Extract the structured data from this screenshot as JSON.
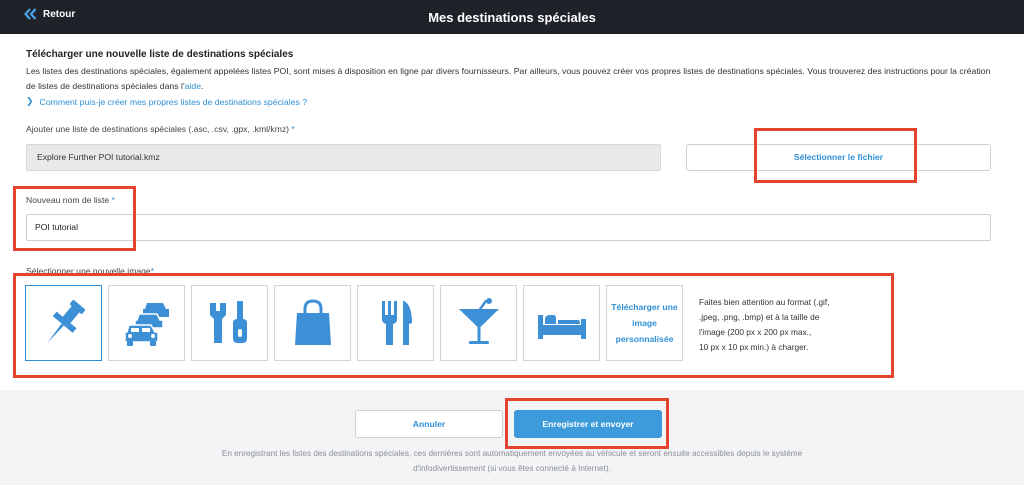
{
  "header": {
    "back_label": "Retour",
    "title": "Mes destinations spéciales"
  },
  "intro": {
    "heading": "Télécharger une nouvelle liste de destinations spéciales",
    "text_1": "Les listes des destinations spéciales, également appelées listes POI, sont mises à disposition en ligne par divers fournisseurs. Par ailleurs, vous pouvez créer vos propres listes de destinations spéciales. Vous trouverez des instructions pour la création de listes de destinations spéciales dans l'",
    "help_link": "aide",
    "text_2": ".",
    "howto_link": "Comment puis-je créer mes propres listes de destinations spéciales ?"
  },
  "file": {
    "label": "Ajouter une liste de destinations spéciales (.asc, .csv, .gpx, .kml/kmz)",
    "required_mark": "*",
    "value": "Explore Further POI tutorial.kmz",
    "select_button": "Sélectionner le fichier"
  },
  "list_name": {
    "label": "Nouveau nom de liste",
    "required_mark": "*",
    "value": "POI tutorial"
  },
  "image_select": {
    "label": "Sélectionner une nouvelle image",
    "required_mark": "*",
    "icons": [
      "pushpin-icon",
      "cars-icon",
      "tools-icon",
      "shopping-bag-icon",
      "restaurant-icon",
      "cocktail-icon",
      "bed-icon"
    ],
    "selected_index": 0,
    "upload_line_1": "Télécharger une",
    "upload_line_2": "image",
    "upload_line_3": "personnalisée",
    "hint_line_1": "Faites bien attention au format (.gif,",
    "hint_line_2": ".jpeg, .png, .bmp) et à la taille de",
    "hint_line_3": "l'image (200 px x 200 px max.,",
    "hint_line_4": "10 px x 10 px min.) à charger."
  },
  "footer": {
    "cancel_button": "Annuler",
    "save_button": "Enregistrer et envoyer",
    "note_line_1": "En enregistrant les listes des destinations spéciales, ces dernières sont automatiquement envoyées au véhicule et seront ensuite accessibles depuis le système",
    "note_line_2": "d'infodivertissement (si vous êtes connecté à Internet)."
  },
  "colors": {
    "accent": "#2e8fd6",
    "primary_button": "#3d9bdc",
    "icon_blue": "#3d8fd6",
    "highlight": "#e4432d",
    "header_bg": "#1f2329"
  }
}
